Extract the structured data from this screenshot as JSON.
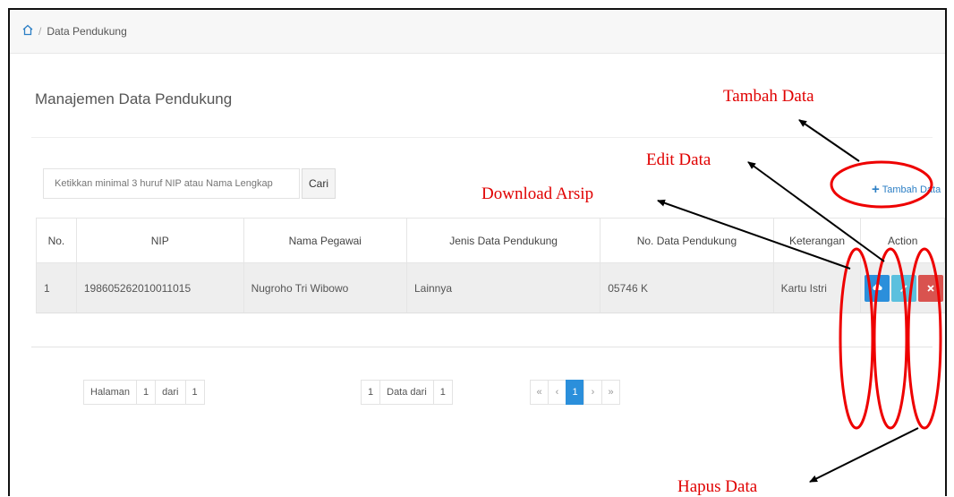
{
  "breadcrumb": {
    "current": "Data Pendukung"
  },
  "page_title": "Manajemen Data Pendukung",
  "search": {
    "placeholder": "Ketikkan minimal 3 huruf NIP atau Nama Lengkap",
    "button_label": "Cari"
  },
  "add_button": {
    "label": "Tambah Data"
  },
  "table": {
    "headers": [
      "No.",
      "NIP",
      "Nama Pegawai",
      "Jenis Data Pendukung",
      "No. Data Pendukung",
      "Keterangan",
      "Action"
    ],
    "rows": [
      {
        "no": "1",
        "nip": "198605262010011015",
        "nama": "Nugroho Tri Wibowo",
        "jenis": "Lainnya",
        "nomor": "05746 K",
        "keterangan": "Kartu Istri"
      }
    ]
  },
  "pagination": {
    "halaman_label": "Halaman",
    "page": "1",
    "dari_label": "dari",
    "total_pages": "1",
    "count": "1",
    "data_dari_label": "Data dari",
    "total_data": "1",
    "nav": [
      "«",
      "‹",
      "1",
      "›",
      "»"
    ]
  },
  "annotations": {
    "tambah": "Tambah Data",
    "edit": "Edit Data",
    "download": "Download Arsip",
    "hapus": "Hapus Data"
  },
  "colors": {
    "annotation": "#e00000",
    "primary": "#2b8fdb",
    "danger": "#d9534f",
    "info": "#5bc0de"
  }
}
